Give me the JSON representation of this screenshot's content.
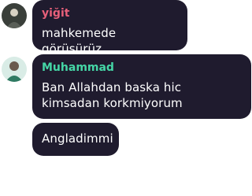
{
  "messages": [
    {
      "author": "yiğit",
      "author_color": "#e8607a",
      "text": "mahkemede görüşürüz"
    },
    {
      "author": "Muhammad",
      "author_color": "#45d6a6",
      "text": "Ban Allahdan baska hic kimsadan korkmiyorum"
    },
    {
      "author": "",
      "text": "Angladimmi"
    }
  ]
}
